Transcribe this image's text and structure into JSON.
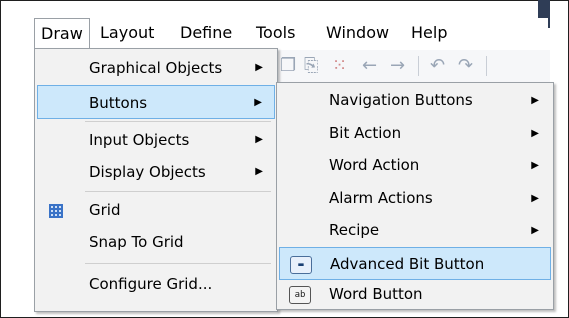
{
  "menubar": {
    "items": [
      {
        "label": "Draw"
      },
      {
        "label": "Layout"
      },
      {
        "label": "Define"
      },
      {
        "label": "Tools"
      },
      {
        "label": "Window"
      },
      {
        "label": "Help"
      }
    ]
  },
  "toolbar": {
    "icons": [
      "copy-icon",
      "paste-icon",
      "grid-dots-icon",
      "arrow-left-icon",
      "arrow-right-icon",
      "undo-icon",
      "redo-icon"
    ]
  },
  "draw_menu": {
    "items": [
      {
        "label": "Graphical Objects",
        "has_submenu": true
      },
      {
        "label": "Buttons",
        "has_submenu": true,
        "highlighted": true
      },
      {
        "label": "Input Objects",
        "has_submenu": true
      },
      {
        "label": "Display Objects",
        "has_submenu": true
      },
      {
        "label": "Grid",
        "icon": "grid-icon"
      },
      {
        "label": "Snap To Grid"
      },
      {
        "label": "Configure Grid..."
      }
    ]
  },
  "buttons_submenu": {
    "items": [
      {
        "label": "Navigation Buttons",
        "has_submenu": true
      },
      {
        "label": "Bit Action",
        "has_submenu": true
      },
      {
        "label": "Word Action",
        "has_submenu": true
      },
      {
        "label": "Alarm Actions",
        "has_submenu": true
      },
      {
        "label": "Recipe",
        "has_submenu": true
      },
      {
        "label": "Advanced Bit Button",
        "icon": "advanced-bit-button-icon",
        "highlighted": true
      },
      {
        "label": "Word Button",
        "icon": "word-button-icon"
      }
    ]
  },
  "icons": {
    "submenu_arrow": "▶",
    "advanced_bit_icon_text": "▬",
    "word_button_icon_text": "ab"
  },
  "colors": {
    "highlight_bg": "#cde8fb",
    "highlight_border": "#6fb0e6",
    "menu_bg": "#f2f2f2"
  }
}
